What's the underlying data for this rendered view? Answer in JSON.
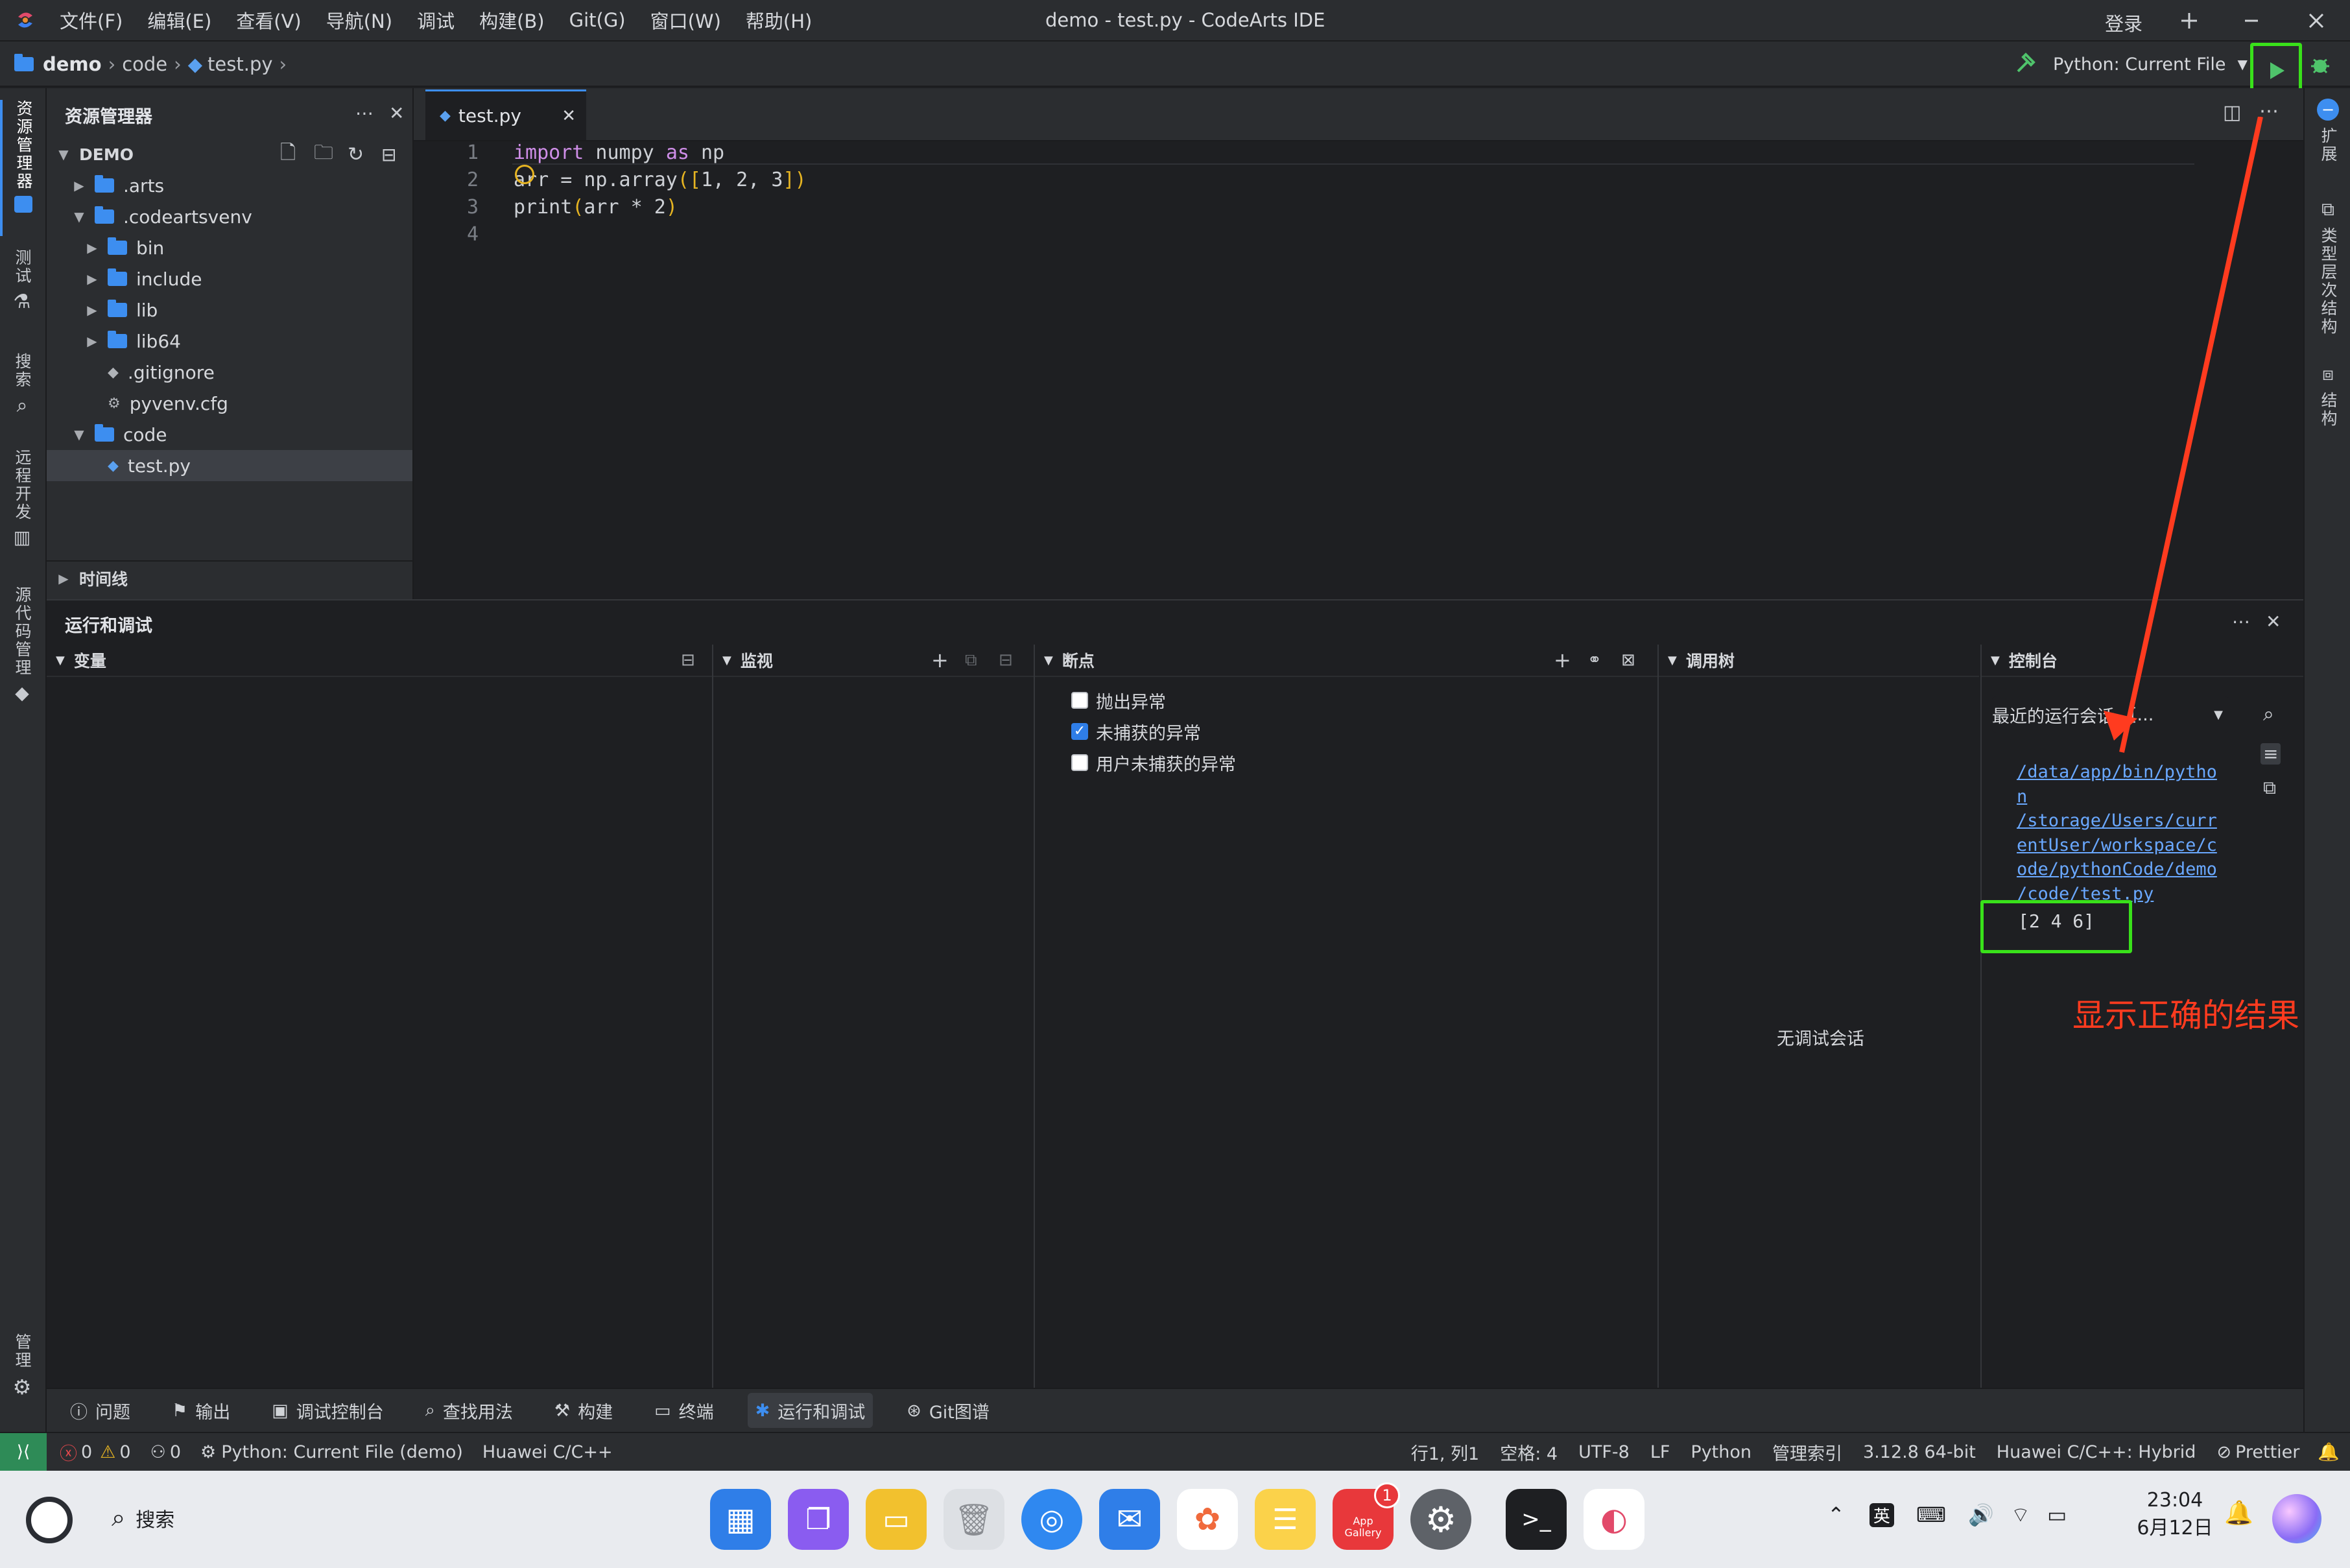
{
  "window": {
    "title": "demo - test.py - CodeArts IDE",
    "menu": [
      "文件(F)",
      "编辑(E)",
      "查看(V)",
      "导航(N)",
      "调试",
      "构建(B)",
      "Git(G)",
      "窗口(W)",
      "帮助(H)"
    ],
    "login": "登录"
  },
  "breadcrumb": {
    "project": "demo",
    "folder": "code",
    "file": "test.py"
  },
  "run_config": {
    "label": "Python: Current File"
  },
  "left_activity": [
    "资源管理器",
    "测试",
    "搜索",
    "远程开发",
    "源代码管理",
    "管理"
  ],
  "right_activity": [
    "扩展",
    "类型层次结构",
    "结构"
  ],
  "explorer": {
    "title": "资源管理器",
    "root": "DEMO",
    "items": [
      {
        "label": ".arts",
        "type": "folder",
        "depth": 1,
        "expanded": false
      },
      {
        "label": ".codeartsvenv",
        "type": "folder",
        "depth": 1,
        "expanded": true
      },
      {
        "label": "bin",
        "type": "folder",
        "depth": 2,
        "expanded": false
      },
      {
        "label": "include",
        "type": "folder",
        "depth": 2,
        "expanded": false
      },
      {
        "label": "lib",
        "type": "folder",
        "depth": 2,
        "expanded": false
      },
      {
        "label": "lib64",
        "type": "folder",
        "depth": 2,
        "expanded": false
      },
      {
        "label": ".gitignore",
        "type": "file",
        "depth": 2
      },
      {
        "label": "pyvenv.cfg",
        "type": "file",
        "depth": 2
      },
      {
        "label": "code",
        "type": "folder",
        "depth": 1,
        "expanded": true
      },
      {
        "label": "test.py",
        "type": "file",
        "depth": 2,
        "selected": true
      }
    ],
    "timeline": "时间线"
  },
  "editor": {
    "tab": "test.py",
    "lines": [
      {
        "n": "1",
        "text": "import numpy as np"
      },
      {
        "n": "2",
        "text": "arr = np.array([1, 2, 3])"
      },
      {
        "n": "3",
        "text": "print(arr * 2)"
      },
      {
        "n": "4",
        "text": ""
      }
    ]
  },
  "panel": {
    "title": "运行和调试",
    "variables": "变量",
    "watch": "监视",
    "breakpoints": {
      "title": "断点",
      "items": [
        {
          "label": "抛出异常",
          "checked": false
        },
        {
          "label": "未捕获的异常",
          "checked": true
        },
        {
          "label": "用户未捕获的异常",
          "checked": false
        }
      ]
    },
    "callstack": {
      "title": "调用树",
      "empty": "无调试会话"
    },
    "console": {
      "title": "控制台",
      "session_label": "最近的运行会话",
      "session_value": "[...",
      "command_lines": [
        "/data/app/bin/pytho",
        "n",
        "/storage/Users/curr",
        "entUser/workspace/c",
        "ode/pythonCode/demo",
        "/code/test.py"
      ],
      "output": "[2 4 6]"
    }
  },
  "annotation": {
    "text": "显示正确的结果",
    "color": "#ff3b1f",
    "highlight": "#39e11a"
  },
  "bottom_tabs": [
    "问题",
    "输出",
    "调试控制台",
    "查找用法",
    "构建",
    "终端",
    "运行和调试",
    "Git图谱"
  ],
  "statusbar": {
    "errors": "0",
    "warnings": "0",
    "ports": "0",
    "launch": "Python: Current File (demo)",
    "lang_server": "Huawei C/C++",
    "position": "行1, 列1",
    "spaces": "空格: 4",
    "encoding": "UTF-8",
    "eol": "LF",
    "language": "Python",
    "index": "管理索引",
    "interpreter": "3.12.8 64-bit",
    "cpp_mode": "Huawei C/C++: Hybrid",
    "prettier": "Prettier"
  },
  "taskbar": {
    "search": "搜索",
    "time": "23:04",
    "date": "6月12日",
    "ime": "英",
    "badge": "1",
    "appgallery": "App Gallery"
  }
}
